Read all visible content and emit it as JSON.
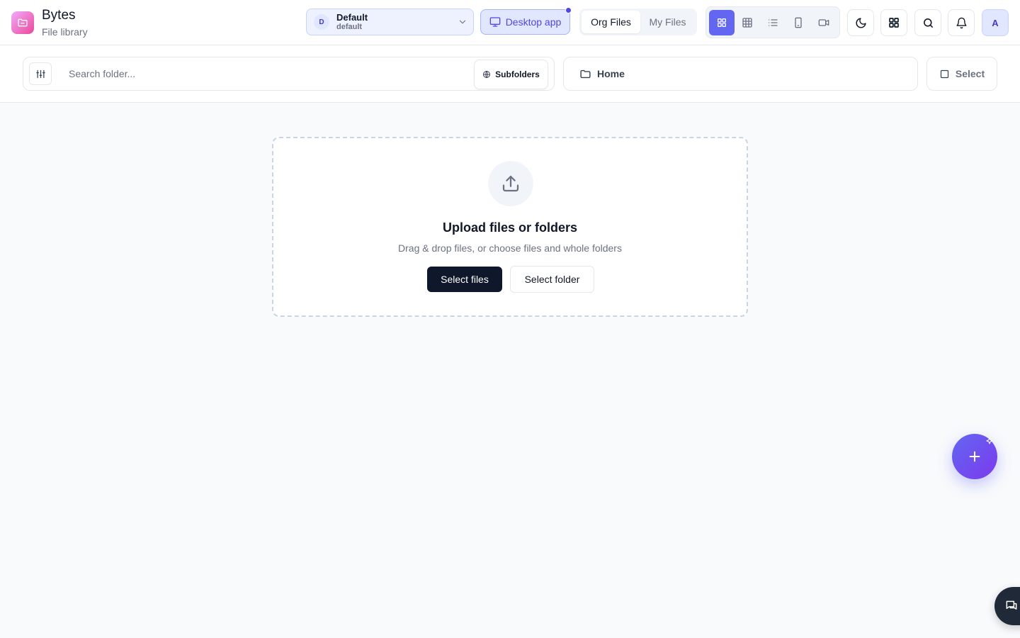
{
  "app": {
    "title": "Bytes",
    "subtitle": "File library",
    "logo_icon": "folder-icon"
  },
  "workspace": {
    "initial": "D",
    "name": "Default",
    "slug": "default"
  },
  "header": {
    "desktop_app_label": "Desktop app",
    "scope_tabs": [
      {
        "label": "Org Files",
        "active": true
      },
      {
        "label": "My Files",
        "active": false
      }
    ],
    "view_modes": [
      {
        "icon": "grid-view-icon",
        "active": true
      },
      {
        "icon": "table-view-icon",
        "active": false
      },
      {
        "icon": "list-view-icon",
        "active": false
      },
      {
        "icon": "mobile-view-icon",
        "active": false
      },
      {
        "icon": "video-view-icon",
        "active": false
      }
    ],
    "actions": [
      "moon-icon",
      "apps-grid-icon",
      "search-icon",
      "bell-icon"
    ],
    "user_initial": "A"
  },
  "toolbar": {
    "search_placeholder": "Search folder...",
    "subfolders_label": "Subfolders",
    "breadcrumb_home": "Home",
    "select_label": "Select"
  },
  "dropzone": {
    "title": "Upload files or folders",
    "subtitle": "Drag & drop files, or choose files and whole folders",
    "select_files_label": "Select files",
    "select_folder_label": "Select folder"
  },
  "colors": {
    "accent": "#6366f1",
    "primary_dark": "#0f172a",
    "background": "#f8fafc"
  }
}
